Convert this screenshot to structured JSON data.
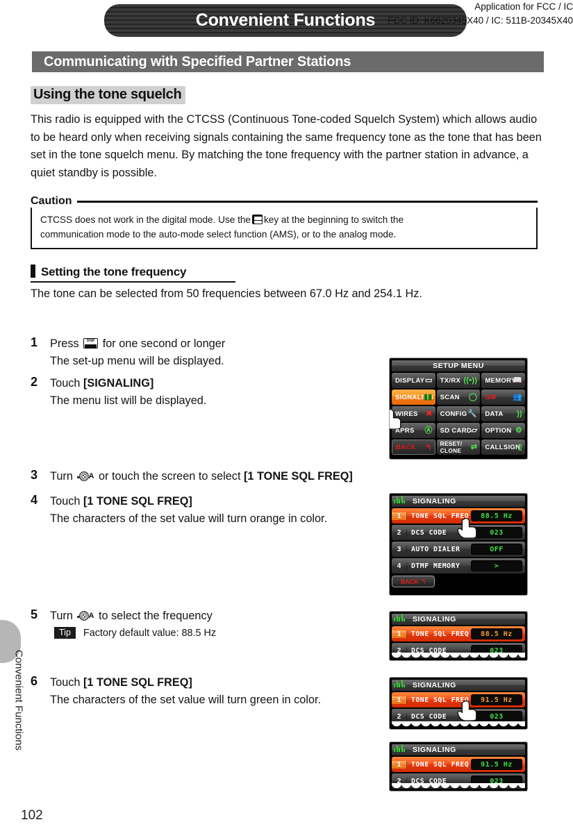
{
  "header": {
    "chapter_title": "Convenient Functions",
    "fcc_line1": "Application for FCC / IC",
    "fcc_line2": "FCC ID: K6620345X40 / IC: 511B-20345X40"
  },
  "section": {
    "band_title": "Communicating with Specified Partner Stations",
    "subhead": "Using the tone squelch",
    "intro": "This radio is equipped with the CTCSS (Continuous Tone-coded Squelch System) which allows audio to be heard only when receiving signals containing the same frequency tone as the tone that has been set in the tone squelch menu. By matching the tone frequency with the partner station in advance, a quiet standby is possible."
  },
  "caution": {
    "label": "Caution",
    "line1_a": "CTCSS does not work in the digital mode. Use the",
    "line1_b": "key at the beginning to switch the",
    "line2": "communication mode to the auto-mode select function (AMS), or to the analog mode."
  },
  "procedure": {
    "title": "Setting the tone frequency",
    "lead": "The tone can be selected from 50 frequencies between 67.0 Hz and 254.1 Hz.",
    "steps": [
      {
        "num": "1",
        "main_a": "Press",
        "main_b": "for one second or longer",
        "sub": "The set-up menu will be displayed.",
        "key_icon": "disp-setup-key"
      },
      {
        "num": "2",
        "main_a": "Touch",
        "main_b": "[SIGNALING]",
        "sub": "The menu list will be displayed."
      },
      {
        "num": "3",
        "main_a": "Turn",
        "main_b": "or touch the screen to select",
        "main_c": "[1 TONE SQL FREQ]",
        "key_icon": "dial-knob"
      },
      {
        "num": "4",
        "main_a": "Touch",
        "main_b": "[1 TONE SQL FREQ]",
        "sub": "The characters of the set value will turn orange in color."
      },
      {
        "num": "5",
        "main_a": "Turn",
        "main_b": "to select the frequency",
        "tip_badge": "Tip",
        "tip_text": "Factory default value: 88.5 Hz",
        "key_icon": "dial-knob"
      },
      {
        "num": "6",
        "main_a": "Touch",
        "main_b": "[1 TONE SQL FREQ]",
        "sub": "The characters of the set value will turn green in color."
      }
    ]
  },
  "screens": {
    "setup_menu": {
      "title": "SETUP MENU",
      "cells": [
        {
          "label": "DISPLAY",
          "icon": "monitor-icon",
          "selected": false
        },
        {
          "label": "TX/RX",
          "icon": "antenna-icon",
          "selected": false
        },
        {
          "label": "MEMORY",
          "icon": "book-icon",
          "selected": false
        },
        {
          "label": "SIGNALING",
          "icon": "bars-icon",
          "selected": true
        },
        {
          "label": "SCAN",
          "icon": "circle-arrow-icon",
          "selected": false
        },
        {
          "label": "GM",
          "icon": "people-icon",
          "selected": false
        },
        {
          "label": "WIRES",
          "icon": "wires-x-icon",
          "selected": false
        },
        {
          "label": "CONFIG",
          "icon": "wrench-icon",
          "selected": false
        },
        {
          "label": "DATA",
          "icon": "wifi-icon",
          "selected": false
        },
        {
          "label": "APRS",
          "icon": "globe-a-icon",
          "selected": false
        },
        {
          "label": "SD CARD",
          "icon": "folder-icon",
          "selected": false
        },
        {
          "label": "OPTION",
          "icon": "gears-icon",
          "selected": false
        },
        {
          "label": "BACK",
          "icon": "back-arrow-icon",
          "selected": false
        },
        {
          "label": "RESET/ CLONE",
          "icon": "swap-arrows-icon",
          "selected": false
        },
        {
          "label": "CALLSIGN",
          "icon": "tag-icon",
          "selected": false
        }
      ]
    },
    "signaling_full": {
      "title": "SIGNALING",
      "rows": [
        {
          "idx": "1",
          "label": "TONE SQL FREQ",
          "value": "88.5 Hz",
          "value_color": "green",
          "highlight": true
        },
        {
          "idx": "2",
          "label": "DCS CODE",
          "value": "023",
          "value_color": "green",
          "highlight": false
        },
        {
          "idx": "3",
          "label": "AUTO DIALER",
          "value": "OFF",
          "value_color": "green",
          "highlight": false
        },
        {
          "idx": "4",
          "label": "DTMF MEMORY",
          "value": ">",
          "value_color": "green",
          "highlight": false
        }
      ],
      "back_label": "BACK"
    },
    "signaling_step5": {
      "title": "SIGNALING",
      "rows": [
        {
          "idx": "1",
          "label": "TONE SQL FREQ",
          "value": "88.5 Hz",
          "value_color": "orange",
          "highlight": true
        },
        {
          "idx": "2",
          "label": "DCS CODE",
          "value": "023",
          "value_color": "green",
          "highlight": false
        }
      ]
    },
    "signaling_step6a": {
      "title": "SIGNALING",
      "rows": [
        {
          "idx": "1",
          "label": "TONE SQL FREQ",
          "value": "91.5 Hz",
          "value_color": "orange",
          "highlight": true
        },
        {
          "idx": "2",
          "label": "DCS CODE",
          "value": "023",
          "value_color": "green",
          "highlight": false
        }
      ]
    },
    "signaling_step6b": {
      "title": "SIGNALING",
      "rows": [
        {
          "idx": "1",
          "label": "TONE SQL FREQ",
          "value": "91.5 Hz",
          "value_color": "green",
          "highlight": true
        },
        {
          "idx": "2",
          "label": "DCS CODE",
          "value": "023",
          "value_color": "green",
          "highlight": false
        }
      ]
    }
  },
  "footer": {
    "edge_label": "Convenient Functions",
    "page_number": "102"
  },
  "colors": {
    "band_gray": "#6b6b6b",
    "highlight_orange": "#ef7712",
    "row_red": "#e0360b",
    "lcd_green": "#3ee23e",
    "lcd_orange": "#ff9b24"
  }
}
